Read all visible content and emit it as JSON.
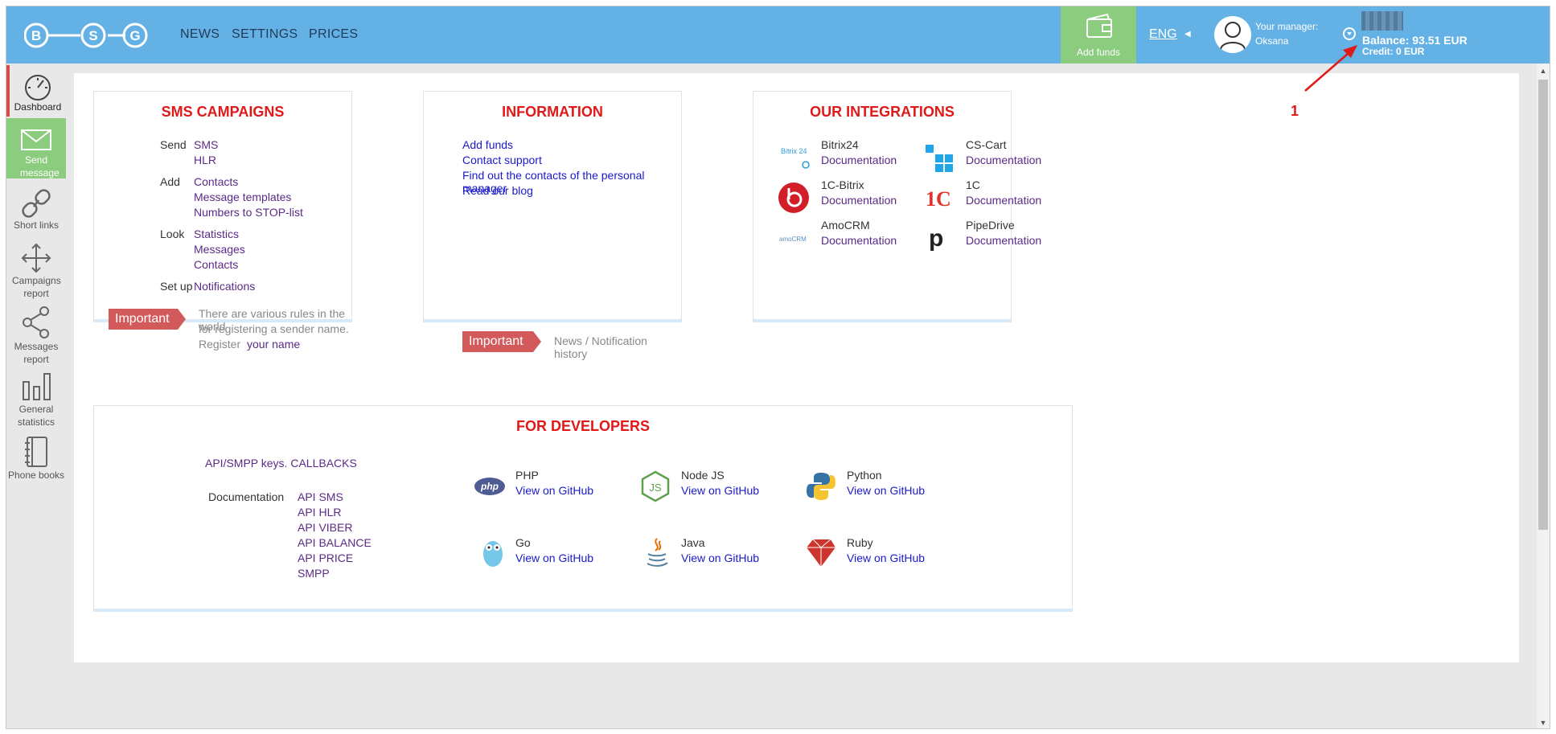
{
  "header": {
    "logo_letters": [
      "B",
      "S",
      "G"
    ],
    "nav": [
      "NEWS",
      "SETTINGS",
      "PRICES"
    ],
    "add_funds": "Add funds",
    "language": "ENG",
    "manager_label": "Your manager:",
    "manager_name": "Oksana",
    "balance": "Balance: 93.51 EUR",
    "credit": "Credit: 0 EUR"
  },
  "sidebar": [
    {
      "label": "Dashboard",
      "icon": "speedometer-icon"
    },
    {
      "label": "Send message",
      "icon": "envelope-icon"
    },
    {
      "label": "Short links",
      "icon": "link-icon"
    },
    {
      "label": "Campaigns report",
      "icon": "move-arrows-icon"
    },
    {
      "label": "Messages report",
      "icon": "share-icon"
    },
    {
      "label": "General statistics",
      "icon": "bar-chart-icon"
    },
    {
      "label": "Phone books",
      "icon": "notebook-icon"
    }
  ],
  "sms": {
    "title": "SMS CAMPAIGNS",
    "send": "Send",
    "send_sms": "SMS",
    "send_hlr": "HLR",
    "add": "Add",
    "add_contacts": "Contacts",
    "add_templates": "Message templates",
    "add_stop": "Numbers to STOP-list",
    "look": "Look",
    "look_stats": "Statistics",
    "look_messages": "Messages",
    "look_contacts": "Contacts",
    "setup": "Set up",
    "setup_notifications": "Notifications",
    "important": "Important",
    "rules_1": "There are various rules in the world",
    "rules_2": "for registering a sender name.",
    "rules_3": "Register",
    "rules_link": "your name"
  },
  "info": {
    "title": "INFORMATION",
    "links": [
      "Add funds",
      "Contact support",
      "Find out the contacts of the personal manager",
      "Read our blog"
    ],
    "important": "Important",
    "news": "News / Notification history"
  },
  "integrations": {
    "title": "OUR INTEGRATIONS",
    "items": [
      {
        "name": "Bitrix24",
        "doc": "Documentation",
        "logo_text": "Bitrix 24"
      },
      {
        "name": "CS-Cart",
        "doc": "Documentation"
      },
      {
        "name": "1C-Bitrix",
        "doc": "Documentation"
      },
      {
        "name": "1C",
        "doc": "Documentation",
        "logo_text": "1C"
      },
      {
        "name": "AmoCRM",
        "doc": "Documentation",
        "logo_text": "amoCRM"
      },
      {
        "name": "PipeDrive",
        "doc": "Documentation",
        "logo_text": "p"
      }
    ]
  },
  "dev": {
    "title": "FOR DEVELOPERS",
    "api_keys": "API/SMPP keys. CALLBACKS",
    "doc_label": "Documentation",
    "docs": [
      "API SMS",
      "API HLR",
      "API VIBER",
      "API BALANCE",
      "API PRICE",
      "SMPP"
    ],
    "langs": [
      {
        "name": "PHP",
        "link": "View on GitHub",
        "logo_text": "php"
      },
      {
        "name": "Node JS",
        "link": "View on GitHub",
        "logo_text": "JS"
      },
      {
        "name": "Python",
        "link": "View on GitHub"
      },
      {
        "name": "Go",
        "link": "View on GitHub"
      },
      {
        "name": "Java",
        "link": "View on GitHub"
      },
      {
        "name": "Ruby",
        "link": "View on GitHub"
      }
    ]
  },
  "annotation": {
    "number": "1"
  },
  "colors": {
    "header": "#64b1e6",
    "accent_green": "#8bcc7e",
    "title_red": "#e01818",
    "badge": "#d35a5a",
    "link": "#5b2a86"
  }
}
